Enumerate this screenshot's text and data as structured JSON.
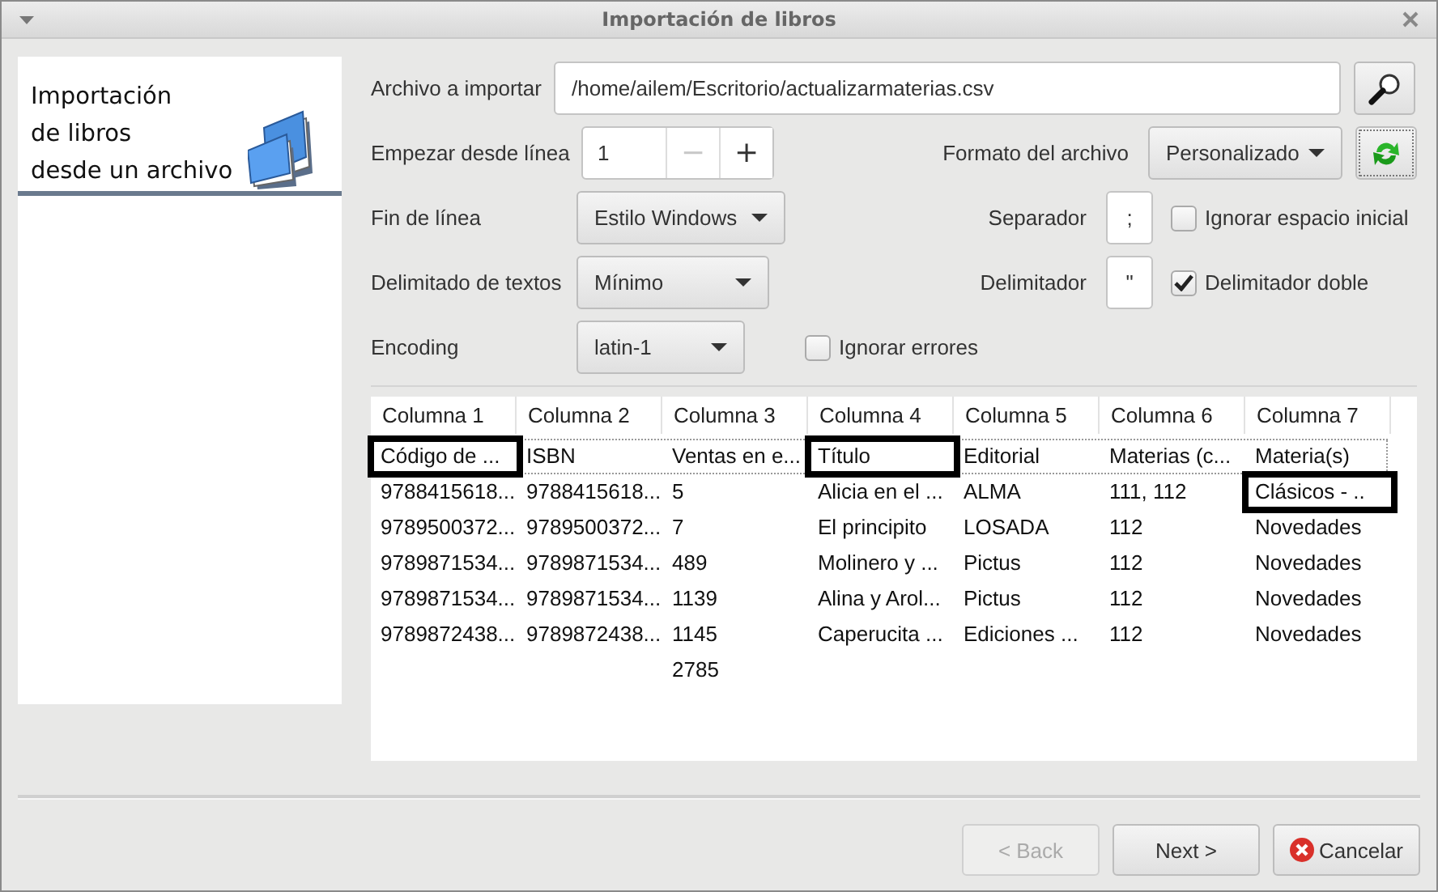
{
  "window": {
    "title": "Importación de libros"
  },
  "sidebar": {
    "heading": "Importación\nde libros\ndesde un archivo"
  },
  "file_row": {
    "label": "Archivo a importar",
    "value": "/home/ailem/Escritorio/actualizarmaterias.csv"
  },
  "start_row": {
    "label": "Empezar desde línea",
    "value": "1",
    "decrement": {
      "label": "−",
      "disabled": true
    },
    "increment": {
      "label": "+",
      "disabled": false
    }
  },
  "format": {
    "label": "Formato del archivo",
    "value": "Personalizado"
  },
  "line_end": {
    "label": "Fin de línea",
    "value": "Estilo Windows"
  },
  "separator": {
    "label": "Separador",
    "value": ";"
  },
  "text_delimiting": {
    "label": "Delimitado de textos",
    "value": "Mínimo"
  },
  "delimiter": {
    "label": "Delimitador",
    "value": "\""
  },
  "encoding": {
    "label": "Encoding",
    "value": "latin-1"
  },
  "checkboxes": [
    {
      "label": "Ignorar espacio inicial",
      "checked": false
    },
    {
      "label": "Delimitador doble",
      "checked": true
    },
    {
      "label": "Ignorar errores",
      "checked": false
    }
  ],
  "table": {
    "columns": [
      "Columna 1",
      "Columna 2",
      "Columna 3",
      "Columna 4",
      "Columna 5",
      "Columna 6",
      "Columna 7"
    ],
    "rows": [
      {
        "focused": true,
        "cells": [
          {
            "text": "Código de ...",
            "highlighted": true
          },
          {
            "text": "ISBN",
            "highlighted": false
          },
          {
            "text": "Ventas en e...",
            "highlighted": false
          },
          {
            "text": "Título",
            "highlighted": true
          },
          {
            "text": "Editorial",
            "highlighted": false
          },
          {
            "text": "Materias (c...",
            "highlighted": false
          },
          {
            "text": "Materia(s)",
            "highlighted": false
          }
        ]
      },
      {
        "focused": false,
        "cells": [
          {
            "text": "9788415618...",
            "highlighted": false
          },
          {
            "text": "9788415618...",
            "highlighted": false
          },
          {
            "text": "5",
            "highlighted": false
          },
          {
            "text": "Alicia en el ...",
            "highlighted": false
          },
          {
            "text": "ALMA",
            "highlighted": false
          },
          {
            "text": "111, 112",
            "highlighted": false
          },
          {
            "text": "Clásicos - ..",
            "highlighted": true
          }
        ]
      },
      {
        "focused": false,
        "cells": [
          {
            "text": "9789500372...",
            "highlighted": false
          },
          {
            "text": "9789500372...",
            "highlighted": false
          },
          {
            "text": "7",
            "highlighted": false
          },
          {
            "text": "El principito",
            "highlighted": false
          },
          {
            "text": "LOSADA",
            "highlighted": false
          },
          {
            "text": "112",
            "highlighted": false
          },
          {
            "text": "Novedades",
            "highlighted": false
          }
        ]
      },
      {
        "focused": false,
        "cells": [
          {
            "text": "9789871534...",
            "highlighted": false
          },
          {
            "text": "9789871534...",
            "highlighted": false
          },
          {
            "text": "489",
            "highlighted": false
          },
          {
            "text": "Molinero y ...",
            "highlighted": false
          },
          {
            "text": "Pictus",
            "highlighted": false
          },
          {
            "text": "112",
            "highlighted": false
          },
          {
            "text": "Novedades",
            "highlighted": false
          }
        ]
      },
      {
        "focused": false,
        "cells": [
          {
            "text": "9789871534...",
            "highlighted": false
          },
          {
            "text": "9789871534...",
            "highlighted": false
          },
          {
            "text": "1139",
            "highlighted": false
          },
          {
            "text": "Alina y Arol...",
            "highlighted": false
          },
          {
            "text": "Pictus",
            "highlighted": false
          },
          {
            "text": "112",
            "highlighted": false
          },
          {
            "text": "Novedades",
            "highlighted": false
          }
        ]
      },
      {
        "focused": false,
        "cells": [
          {
            "text": "9789872438...",
            "highlighted": false
          },
          {
            "text": "9789872438...",
            "highlighted": false
          },
          {
            "text": "1145",
            "highlighted": false
          },
          {
            "text": "Caperucita ...",
            "highlighted": false
          },
          {
            "text": "Ediciones ...",
            "highlighted": false
          },
          {
            "text": "112",
            "highlighted": false
          },
          {
            "text": "Novedades",
            "highlighted": false
          }
        ]
      },
      {
        "focused": false,
        "cells": [
          null,
          null,
          {
            "text": "2785",
            "highlighted": false
          },
          null,
          null,
          null,
          null
        ]
      }
    ]
  },
  "buttons": [
    {
      "label": "< Back",
      "disabled": true,
      "kind": "back"
    },
    {
      "label": "Next >",
      "disabled": false,
      "kind": "next"
    },
    {
      "label": "Cancelar",
      "disabled": false,
      "kind": "cancel"
    }
  ]
}
